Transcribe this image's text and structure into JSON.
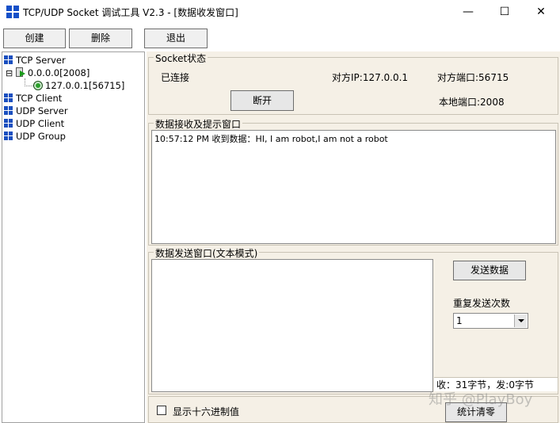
{
  "window": {
    "title": "TCP/UDP Socket 调试工具 V2.3 - [数据收发窗口]",
    "minimize": "—",
    "maximize": "☐",
    "close": "✕"
  },
  "toolbar": {
    "create": "创建",
    "delete": "删除",
    "exit": "退出"
  },
  "tree": {
    "tcp_server": "TCP Server",
    "listener": "0.0.0.0[2008]",
    "client": "127.0.0.1[56715]",
    "tcp_client": "TCP Client",
    "udp_server": "UDP Server",
    "udp_client": "UDP Client",
    "udp_group": "UDP Group",
    "collapse_symbol": "⊟"
  },
  "socket_status": {
    "label": "Socket状态",
    "state": "已连接",
    "remote_ip": "对方IP:127.0.0.1",
    "remote_port": "对方端口:56715",
    "local_port": "本地端口:2008",
    "disconnect": "断开"
  },
  "receive": {
    "label": "数据接收及提示窗口",
    "log": "10:57:12 PM 收到数据：HI, I am robot,I am not a robot"
  },
  "send": {
    "label": "数据发送窗口(文本模式)",
    "send_button": "发送数据",
    "repeat_label": "重复发送次数",
    "repeat_value": "1",
    "stats": "收：31字节，发:0字节"
  },
  "bottom": {
    "hex_checkbox": "显示十六进制值",
    "clear_stats": "统计清零"
  },
  "watermark": "知乎 @PlayBoy"
}
